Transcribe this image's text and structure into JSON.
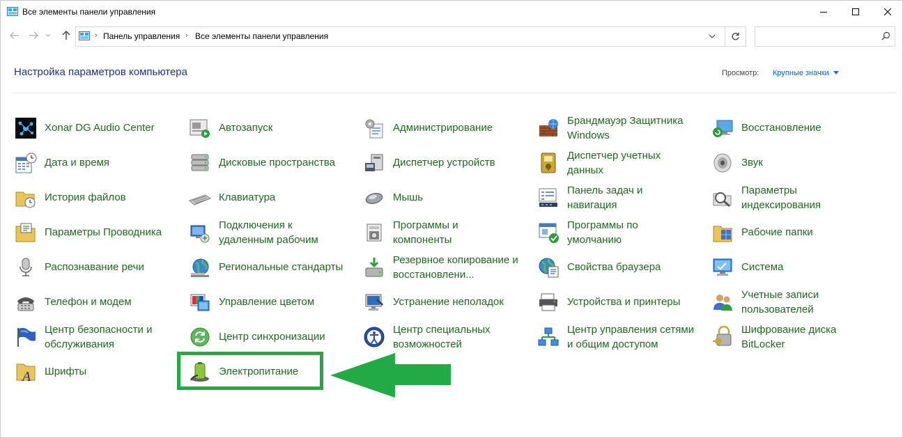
{
  "window": {
    "title": "Все элементы панели управления"
  },
  "address": {
    "crumbs": [
      "Панель управления",
      "Все элементы панели управления"
    ]
  },
  "search": {
    "placeholder": ""
  },
  "header": {
    "title": "Настройка параметров компьютера",
    "view_by_label": "Просмотр:",
    "view_by_value": "Крупные значки"
  },
  "items": [
    {
      "label": "Xonar DG Audio Center",
      "icon": "xonar-audio-icon"
    },
    {
      "label": "Автозапуск",
      "icon": "autoplay-icon"
    },
    {
      "label": "Администрирование",
      "icon": "admin-tools-icon"
    },
    {
      "label": "Брандмауэр Защитника\nWindows",
      "icon": "firewall-icon"
    },
    {
      "label": "Восстановление",
      "icon": "recovery-icon"
    },
    {
      "label": "Дата и время",
      "icon": "date-time-icon"
    },
    {
      "label": "Дисковые пространства",
      "icon": "storage-spaces-icon"
    },
    {
      "label": "Диспетчер устройств",
      "icon": "device-manager-icon"
    },
    {
      "label": "Диспетчер учетных\nданных",
      "icon": "credential-manager-icon"
    },
    {
      "label": "Звук",
      "icon": "sound-icon"
    },
    {
      "label": "История файлов",
      "icon": "file-history-icon"
    },
    {
      "label": "Клавиатура",
      "icon": "keyboard-icon"
    },
    {
      "label": "Мышь",
      "icon": "mouse-icon"
    },
    {
      "label": "Панель задач и\nнавигация",
      "icon": "taskbar-icon"
    },
    {
      "label": "Параметры\nиндексирования",
      "icon": "indexing-icon"
    },
    {
      "label": "Параметры Проводника",
      "icon": "explorer-options-icon"
    },
    {
      "label": "Подключения к\nудаленным рабочим",
      "icon": "remote-desktop-icon"
    },
    {
      "label": "Программы и\nкомпоненты",
      "icon": "programs-icon"
    },
    {
      "label": "Программы по\nумолчанию",
      "icon": "default-programs-icon"
    },
    {
      "label": "Рабочие папки",
      "icon": "work-folders-icon"
    },
    {
      "label": "Распознавание речи",
      "icon": "microphone-icon"
    },
    {
      "label": "Региональные стандарты",
      "icon": "region-globe-icon"
    },
    {
      "label": "Резервное копирование и\nвосстановлени...",
      "icon": "backup-icon"
    },
    {
      "label": "Свойства браузера",
      "icon": "internet-options-icon"
    },
    {
      "label": "Система",
      "icon": "system-icon"
    },
    {
      "label": "Телефон и модем",
      "icon": "phone-modem-icon"
    },
    {
      "label": "Управление цветом",
      "icon": "color-management-icon"
    },
    {
      "label": "Устранение неполадок",
      "icon": "troubleshooting-icon"
    },
    {
      "label": "Устройства и принтеры",
      "icon": "printers-icon"
    },
    {
      "label": "Учетные записи\nпользователей",
      "icon": "user-accounts-icon"
    },
    {
      "label": "Центр безопасности и\nобслуживания",
      "icon": "security-flag-icon"
    },
    {
      "label": "Центр синхронизации",
      "icon": "sync-center-icon"
    },
    {
      "label": "Центр специальных\nвозможностей",
      "icon": "ease-of-access-icon"
    },
    {
      "label": "Центр управления сетями\nи общим доступом",
      "icon": "network-center-icon"
    },
    {
      "label": "Шифрование диска\nBitLocker",
      "icon": "bitlocker-icon"
    },
    {
      "label": "Шрифты",
      "icon": "fonts-icon"
    },
    {
      "label": "Электропитание",
      "icon": "power-options-icon"
    }
  ],
  "colors": {
    "item_text": "#1e6b1e",
    "heading_text": "#1e3287",
    "link_blue": "#0066cc",
    "highlight": "#22aa44"
  }
}
